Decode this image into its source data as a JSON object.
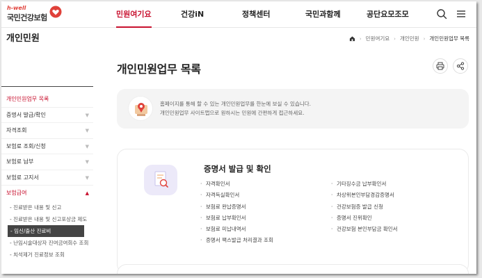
{
  "brand": {
    "logo_sub": "h-well",
    "logo_main": "국민건강보험"
  },
  "gnb": {
    "items": [
      {
        "label": "민원여기요",
        "active": true
      },
      {
        "label": "건강iN",
        "active": false
      },
      {
        "label": "정책센터",
        "active": false
      },
      {
        "label": "국민과함께",
        "active": false
      },
      {
        "label": "공단요모조모",
        "active": false
      }
    ],
    "search_icon": "search-icon",
    "menu_icon": "hamburger-menu-icon"
  },
  "breadcrumb": {
    "items": [
      "민원여기요",
      "개인민원",
      "개인민원업무 목록"
    ]
  },
  "sidebar": {
    "title": "개인민원",
    "items": [
      {
        "label": "개인민원업무 목록",
        "active": true
      },
      {
        "label": "증명서 발급/확인"
      },
      {
        "label": "자격조회"
      },
      {
        "label": "보험료 조회/신청"
      },
      {
        "label": "보험료 납부"
      },
      {
        "label": "보험료 고지서"
      },
      {
        "label": "보험급여",
        "open": true
      }
    ],
    "sub_items": [
      "진료받은 내용 및 신고",
      "진료받은 내용 및 신고포상금 제도",
      "임신/출산 진료비",
      "난임시술대상자 진여금여회수 조회",
      "치석제거 진료정보 조회"
    ],
    "selected_sub": 2
  },
  "main": {
    "page_title": "개인민원업무 목록",
    "info": {
      "line1": "홈페이지를 통해 할 수 있는 개인민원업무를 한눈에 보실 수 있습니다.",
      "line2": "개인민원업무 사이트맵으로 원하시는 민원에 간편하게 접근하세요."
    },
    "card": {
      "title": "증명서 발급 및 확인",
      "left_list": [
        "자격확인서",
        "자격득실확인서",
        "보험료 완납증명서",
        "보험료 납부확인서",
        "보험료 미납내역서",
        "증명서 팩스발급 처리결과 조회"
      ],
      "right_list": [
        "기타징수금 납부확인서",
        "차상위본인부담경감증명서",
        "건강보험증 발급 신청",
        "증명서 진위확인",
        "건강보험 본인부담금 확인서"
      ]
    }
  },
  "colors": {
    "accent": "#c8102e",
    "card_icon_bg": "#ece9f9"
  }
}
